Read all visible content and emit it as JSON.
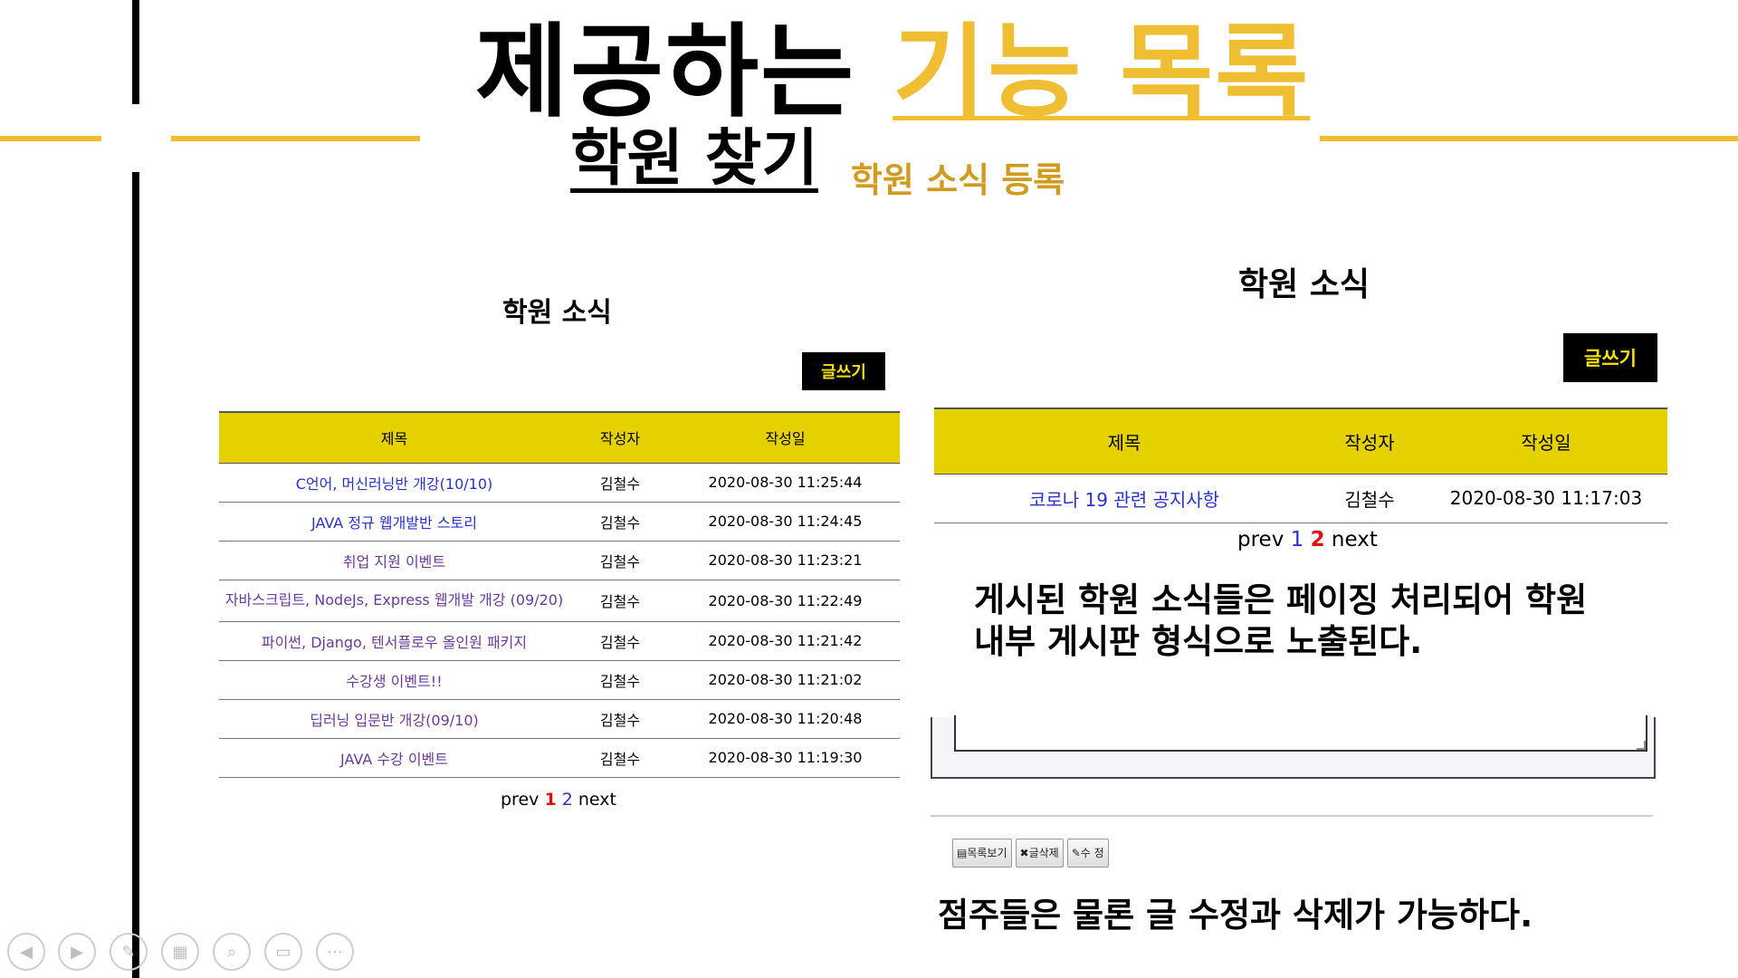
{
  "slide": {
    "title_main": "제공하는",
    "title_accent": "기능 목록",
    "subtitle": "학원 찾기",
    "subtitle_secondary": "학원 소식 등록"
  },
  "left_board": {
    "title": "학원 소식",
    "write_button": "글쓰기",
    "columns": [
      "제목",
      "작성자",
      "작성일"
    ],
    "rows": [
      {
        "title": "C언어, 머신러닝반 개강(10/10)",
        "author": "김철수",
        "date": "2020-08-30 11:25:44"
      },
      {
        "title": "JAVA 정규 웹개발반 스토리",
        "author": "김철수",
        "date": "2020-08-30 11:24:45"
      },
      {
        "title": "취업 지원 이벤트",
        "author": "김철수",
        "date": "2020-08-30 11:23:21"
      },
      {
        "title": "자바스크립트, NodeJs, Express 웹개발 개강 (09/20)",
        "author": "김철수",
        "date": "2020-08-30 11:22:49"
      },
      {
        "title": "파이썬, Django, 텐서플로우 올인원 패키지",
        "author": "김철수",
        "date": "2020-08-30 11:21:42"
      },
      {
        "title": "수강생 이벤트!!",
        "author": "김철수",
        "date": "2020-08-30 11:21:02"
      },
      {
        "title": "딥러닝 입문반 개강(09/10)",
        "author": "김철수",
        "date": "2020-08-30 11:20:48"
      },
      {
        "title": "JAVA 수강 이벤트",
        "author": "김철수",
        "date": "2020-08-30 11:19:30"
      }
    ],
    "pager": {
      "prev": "prev",
      "page1": "1",
      "page2": "2",
      "next": "next"
    }
  },
  "right_board": {
    "title": "학원 소식",
    "write_button": "글쓰기",
    "columns": [
      "제목",
      "작성자",
      "작성일"
    ],
    "rows": [
      {
        "title": "코로나 19 관련 공지사항",
        "author": "김철수",
        "date": "2020-08-30 11:17:03"
      }
    ],
    "pager": {
      "prev": "prev",
      "page1": "1",
      "page2": "2",
      "next": "next"
    },
    "caption_line1": "게시된 학원 소식들은 페이징 처리되어 학원",
    "caption_line2": "내부 게시판 형식으로 노출된다."
  },
  "detail_view": {
    "buttons": [
      "목록보기",
      "글삭제",
      "수 정"
    ],
    "caption": "점주들은 물론 글 수정과 삭제가 가능하다."
  },
  "controls": [
    "prev-slide-icon",
    "next-slide-icon",
    "pen-icon",
    "slides-grid-icon",
    "zoom-icon",
    "subtitles-icon",
    "more-icon"
  ],
  "colors": {
    "accent": "#F0BE32",
    "table_header": "#E5D000",
    "link": "#2A33CC",
    "current_page": "#E01010"
  }
}
